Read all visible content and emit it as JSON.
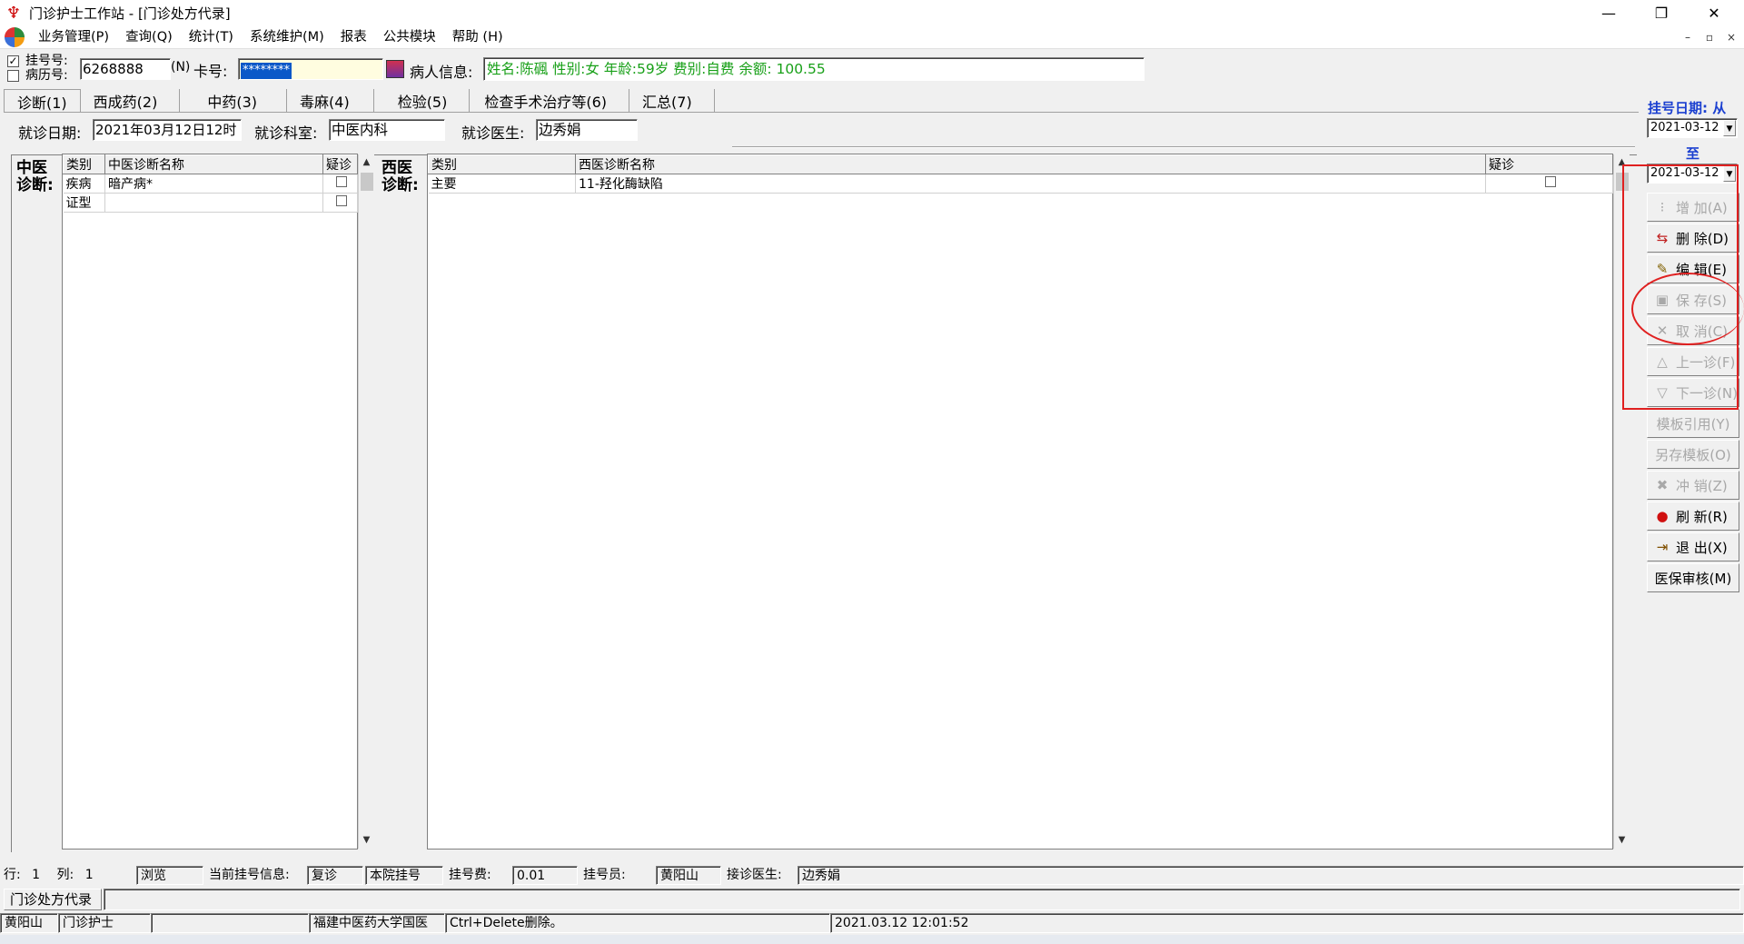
{
  "window": {
    "title": "门诊护士工作站 - [门诊处方代录]",
    "controls": [
      "—",
      "❐",
      "✕"
    ],
    "mdi_controls": [
      "–",
      "▫",
      "×"
    ]
  },
  "menu": [
    "业务管理(P)",
    "查询(Q)",
    "统计(T)",
    "系统维护(M)",
    "报表",
    "公共模块",
    "帮助 (H)"
  ],
  "patient_bar": {
    "reg_label": "挂号号:",
    "record_label": "病历号:",
    "reg_checked": "✓",
    "reg_value": "6268888",
    "n_label": "(N)",
    "card_label": "卡号:",
    "card_value": "********",
    "info_label": "病人信息:",
    "info_value": "姓名:陈碸 性别:女 年龄:59岁 费别:自费 余额: 100.55"
  },
  "tabs": [
    "诊断(1)",
    "西成药(2)",
    "中药(3)",
    "毒麻(4)",
    "检验(5)",
    "检查手术治疗等(6)",
    "汇总(7)"
  ],
  "visit": {
    "date_label": "就诊日期:",
    "date_value": "2021年03月12日12时",
    "dept_label": "就诊科室:",
    "dept_value": "中医内科",
    "doctor_label": "就诊医生:",
    "doctor_value": "边秀娟"
  },
  "tcm": {
    "side_label_1": "中医",
    "side_label_2": "诊断:",
    "headers": [
      "类别",
      "中医诊断名称",
      "疑诊"
    ],
    "rows": [
      {
        "category": "疾病",
        "name": "暗产病*"
      },
      {
        "category": "证型",
        "name": ""
      }
    ]
  },
  "western": {
    "side_label_1": "西医",
    "side_label_2": "诊断:",
    "headers": [
      "类别",
      "西医诊断名称",
      "疑诊"
    ],
    "rows": [
      {
        "category": "主要",
        "name": "11-羟化酶缺陷"
      }
    ]
  },
  "right_panel": {
    "date_from_label": "挂号日期: 从",
    "date_from": "2021-03-12",
    "date_to_label": "至",
    "date_to": "2021-03-12",
    "buttons": [
      {
        "label": "增 加(A)",
        "icon": "⁝",
        "enabled": false
      },
      {
        "label": "删 除(D)",
        "icon": "⇆",
        "enabled": true
      },
      {
        "label": "编 辑(E)",
        "icon": "✎",
        "enabled": true
      },
      {
        "label": "保 存(S)",
        "icon": "▣",
        "enabled": false
      },
      {
        "label": "取 消(C)",
        "icon": "✕",
        "enabled": false
      },
      {
        "label": "上一诊(F)",
        "icon": "△",
        "enabled": false
      },
      {
        "label": "下一诊(N)",
        "icon": "▽",
        "enabled": false
      },
      {
        "label": "模板引用(Y)",
        "icon": "",
        "enabled": false
      },
      {
        "label": "另存模板(O)",
        "icon": "",
        "enabled": false
      },
      {
        "label": "冲 销(Z)",
        "icon": "✖",
        "enabled": false
      },
      {
        "label": "刷 新(R)",
        "icon": "●",
        "enabled": true
      },
      {
        "label": "退 出(X)",
        "icon": "⇥",
        "enabled": true
      },
      {
        "label": "医保审核(M)",
        "icon": "",
        "enabled": true
      }
    ]
  },
  "status_bar": {
    "row_label": "行:",
    "row_value": "1",
    "col_label": "列:",
    "col_value": "1",
    "mode": "浏览",
    "reg_info_label": "当前挂号信息:",
    "reg_info_value": "复诊",
    "reg_type": "本院挂号",
    "fee_label": "挂号费:",
    "fee_value": "0.01",
    "registrar_label": "挂号员:",
    "registrar_value": "黄阳山",
    "doctor_label": "接诊医生:",
    "doctor_value": "边秀娟"
  },
  "window_tab": "门诊处方代录",
  "bottom_bar": {
    "user": "黄阳山",
    "role": "门诊护士",
    "empty": "",
    "hospital": "福建中医药大学国医",
    "hint": "Ctrl+Delete删除。",
    "datetime": "2021.03.12 12:01:52"
  },
  "accent_colors": {
    "patient_info_text": "#18a018",
    "date_label_blue": "#1a3fd0",
    "annotation_red": "#e02020",
    "selection_blue": "#0a58c8"
  }
}
